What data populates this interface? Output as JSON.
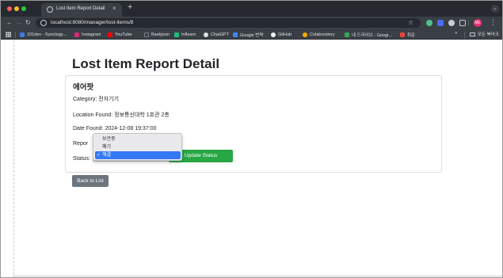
{
  "browser": {
    "tab_title": "Lost Item Report Detail",
    "tab_close": "×",
    "new_tab": "+",
    "url": "localhost:8080/manager/lost-items/8",
    "profile_initials": "ME",
    "bookmarks": [
      {
        "label": "101dev - Synology...",
        "icon": "blue-square-icon",
        "color": "#3f7be0"
      },
      {
        "label": "Instagram",
        "icon": "instagram-icon",
        "color": "#d62976"
      },
      {
        "label": "YouTube",
        "icon": "youtube-icon",
        "color": "#ff0000"
      },
      {
        "label": "Baekjoon",
        "icon": "baekjoon-icon",
        "color": "#3a3f46"
      },
      {
        "label": "Inflearn",
        "icon": "inflearn-icon",
        "color": "#1dc078"
      },
      {
        "label": "ChatGPT",
        "icon": "chatgpt-icon",
        "color": "#dfe1e5"
      },
      {
        "label": "Google 번역",
        "icon": "google-translate-icon",
        "color": "#4285f4"
      },
      {
        "label": "GitHub",
        "icon": "github-icon",
        "color": "#f0f0f0"
      },
      {
        "label": "Colaboratory",
        "icon": "colab-icon",
        "color": "#f9ab00"
      },
      {
        "label": "내 드라이브 - Googl...",
        "icon": "google-drive-icon",
        "color": "#34a853"
      },
      {
        "label": "취준",
        "icon": "folder-red-icon",
        "color": "#e8433a"
      }
    ],
    "bookmarks_more": "»",
    "bookmarks_folder": "모든 북마크"
  },
  "page": {
    "title": "Lost Item Report Detail",
    "item_name": "에어팟",
    "category": "Category: 전자기기",
    "location": "Location Found: 정보통신대학 1호관 2층",
    "date_found": "Date Found: 2024-12-08 19:37:00",
    "report_label": "Repor",
    "status_label": "Status:",
    "update_button": "Update Status",
    "back_button": "Back to List"
  },
  "status_dropdown": {
    "options": [
      "보관중",
      "폐기",
      "해결"
    ],
    "selected": "해결",
    "check": "✓"
  },
  "colors": {
    "tab_strip": "#262a30",
    "toolbar": "#3a3f46",
    "update_button": "#28a745",
    "back_button": "#6c757d",
    "dropdown_highlight": "#3478f6"
  }
}
